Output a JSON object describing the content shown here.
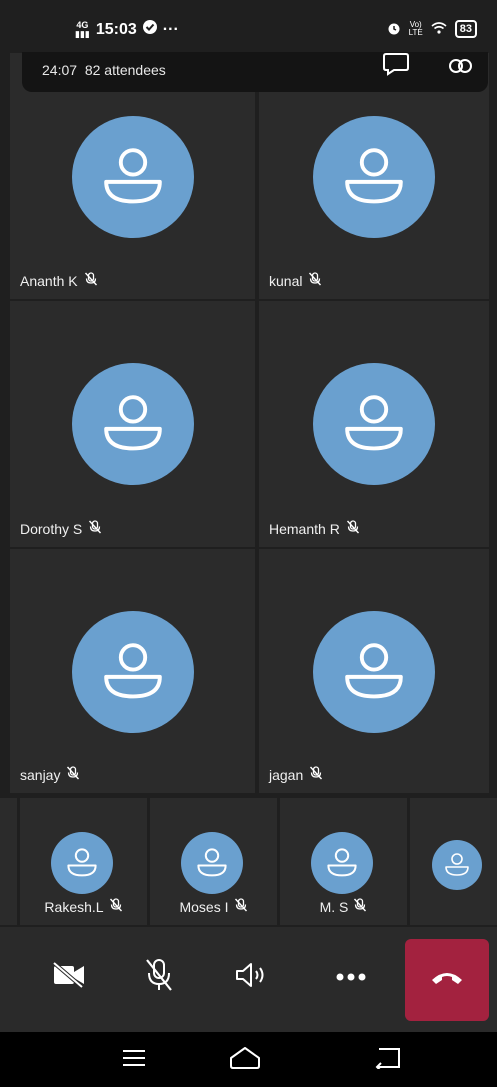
{
  "status": {
    "network": "4G",
    "time": "15:03",
    "battery": "83"
  },
  "meeting": {
    "duration": "24:07",
    "attendees": "82 attendees"
  },
  "participants": [
    {
      "name": "Ananth K",
      "muted": true
    },
    {
      "name": "kunal",
      "muted": true
    },
    {
      "name": "Dorothy S",
      "muted": true
    },
    {
      "name": "Hemanth R",
      "muted": true
    },
    {
      "name": "sanjay",
      "muted": true
    },
    {
      "name": "jagan",
      "muted": true
    }
  ],
  "strip": [
    {
      "name": "Rakesh.L",
      "muted": true
    },
    {
      "name": "Moses I",
      "muted": true
    },
    {
      "name": "M. S",
      "muted": true
    },
    {
      "name": "",
      "muted": false
    }
  ],
  "toolbar": {
    "camera": "camera-off-icon",
    "mic": "mic-off-icon",
    "speaker": "speaker-icon",
    "more": "more-icon",
    "end": "end-call-icon"
  },
  "colors": {
    "avatar": "#6aa0cf",
    "end_call": "#a3223f",
    "tile": "#2b2b2b",
    "toolbar": "#2a2a2a"
  }
}
